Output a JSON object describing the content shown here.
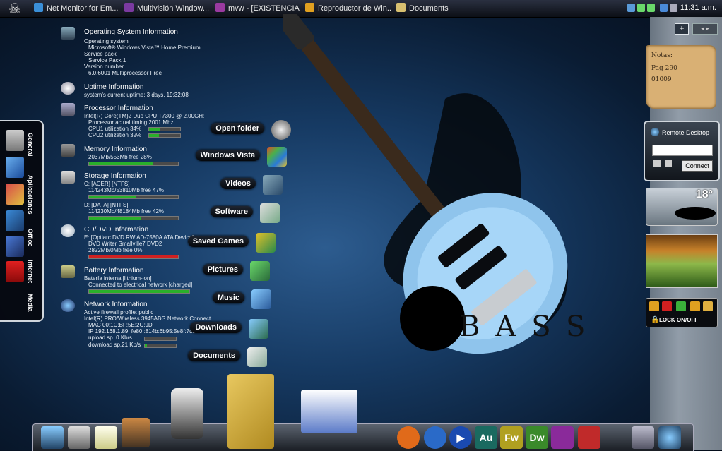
{
  "taskbar": {
    "tasks": [
      {
        "label": "Net Monitor for Em...",
        "color": "#3a8fd8"
      },
      {
        "label": "Multivisión Window...",
        "color": "#7b3aa0"
      },
      {
        "label": "mvw - [EXISTENCIA ...",
        "color": "#9a3aa0"
      },
      {
        "label": "Reproductor de Win...",
        "color": "#e0a020"
      },
      {
        "label": "Documents",
        "color": "#d8c070"
      }
    ],
    "clock": "11:31 a.m."
  },
  "side_launcher": {
    "labels": [
      "General",
      "Aplicaciones",
      "Office",
      "Internet",
      "Media"
    ],
    "icons": [
      "calculator-icon",
      "app-blue-icon",
      "brushes-icon",
      "office-icon",
      "media-icon",
      "pdf-icon"
    ]
  },
  "sysinfo": {
    "os": {
      "title": "Operating System Information",
      "lines": [
        "Operating system",
        "Microsoft® Windows Vista™ Home Premium",
        "Service pack",
        "Service Pack 1",
        "Version number",
        "6.0.6001  Multiprocessor Free"
      ]
    },
    "uptime": {
      "title": "Uptime Information",
      "lines": [
        "system's current uptime: 3 days, 19:32:08"
      ]
    },
    "processor": {
      "title": "Processor Information",
      "lines": [
        "Intel(R) Core(TM)2 Duo CPU     T7300  @ 2.00GH:",
        "Processor actual timing 2001 Mhz",
        "CPU1 utilization   34%",
        "CPU2 utilization   32%"
      ],
      "cpu1": 0.34,
      "cpu2": 0.32
    },
    "memory": {
      "title": "Memory Information",
      "lines": [
        "2037Mb/553Mb  free 28%"
      ],
      "used": 0.72
    },
    "storage": {
      "title": "Storage Information",
      "lines": [
        "C: [ACER]  [NTFS]",
        "114243Mb/53810Mb  free 47%",
        "D: [DATA]  [NTFS]",
        "114230Mb/48184Mb  free 42%"
      ],
      "c_used": 0.53,
      "d_used": 0.58
    },
    "cddvd": {
      "title": "CD/DVD Information",
      "lines": [
        "E: [Optiarc DVD RW AD-7580A ATA Device]",
        "DVD Writer          Smallville7 DVD2",
        "2822Mb/0Mb  free 0%"
      ],
      "used": 1.0
    },
    "battery": {
      "title": "Battery Information",
      "lines": [
        "Batería interna [lithium-ion]",
        "Connected to electrical network [charged]"
      ],
      "level": 1.0
    },
    "network": {
      "title": "Network Information",
      "lines": [
        "Active firewall profile: public",
        "Intel(R) PRO/Wireless 3945ABG Network Connect",
        "MAC 00:1C:BF:5E:2C:9D",
        "IP  192.168.1.89,  fe80::814b:6b95:5e8f:7db5",
        "upload sp.     0 Kb/s",
        "download sp.21 Kb/s"
      ]
    }
  },
  "folders": [
    "Open folder",
    "Windows Vista",
    "Videos",
    "Software",
    "Saved Games",
    "Pictures",
    "Music",
    "Downloads",
    "Documents"
  ],
  "art": {
    "bass_text": "BASS"
  },
  "sidebar": {
    "add_label": "+",
    "note_lines": [
      "Notas:",
      "Pag 290",
      "01009"
    ],
    "remote_desktop": {
      "title": "Remote Desktop",
      "connect_label": "Connect"
    },
    "weather": {
      "temp": "18°"
    },
    "lock": {
      "label": "LOCK ON/OFF"
    }
  },
  "dock": {
    "left_icons": [
      "computer-icon",
      "projector-icon",
      "notes-icon",
      "photos-icon"
    ],
    "right_icons": [
      {
        "name": "firefox-icon",
        "text": "",
        "color": "#e06a1a"
      },
      {
        "name": "globe-icon",
        "text": "",
        "color": "#2a6ac8"
      },
      {
        "name": "media-player-icon",
        "text": "",
        "color": "#1a4ab0"
      },
      {
        "name": "audition-icon",
        "text": "Au",
        "color": "#1a6a60"
      },
      {
        "name": "fireworks-icon",
        "text": "Fw",
        "color": "#b0a020"
      },
      {
        "name": "dreamweaver-icon",
        "text": "Dw",
        "color": "#3a8a2a"
      },
      {
        "name": "multivision-icon",
        "text": "",
        "color": "#8a2a9a"
      },
      {
        "name": "visual-c-icon",
        "text": "",
        "color": "#c02a2a"
      },
      {
        "name": "recycle-bin-icon",
        "text": "",
        "color": "#6a7a8a"
      },
      {
        "name": "network-icon",
        "text": "",
        "color": "#2a8ad0"
      }
    ]
  }
}
